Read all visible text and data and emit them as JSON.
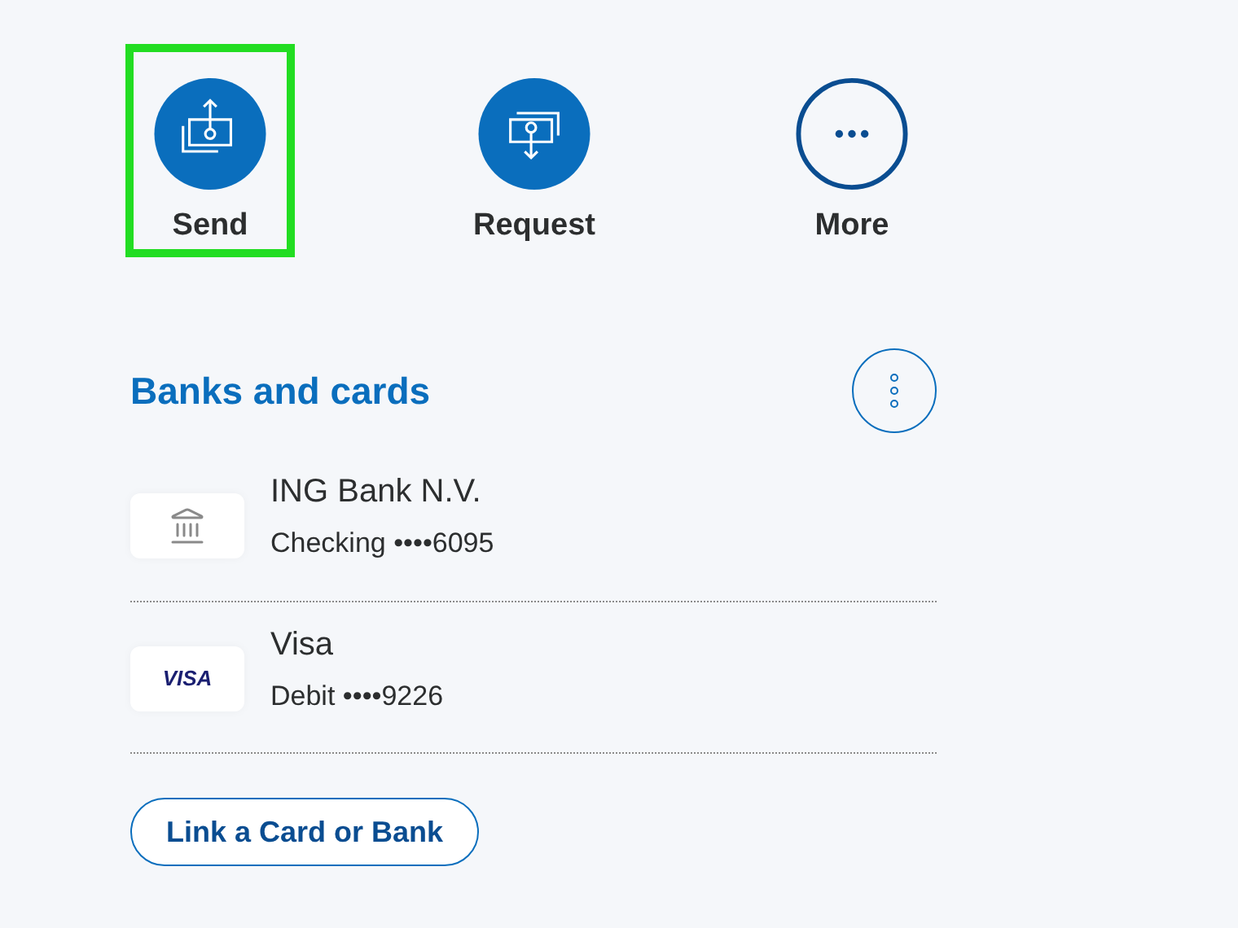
{
  "actions": [
    {
      "kind": "send",
      "label": "Send",
      "highlighted": true
    },
    {
      "kind": "request",
      "label": "Request",
      "highlighted": false
    },
    {
      "kind": "more",
      "label": "More",
      "highlighted": false
    }
  ],
  "banks_and_cards": {
    "title": "Banks and cards",
    "accounts": [
      {
        "kind": "bank",
        "name": "ING Bank N.V.",
        "detail": "Checking ••••6095"
      },
      {
        "kind": "card",
        "logo": "VISA",
        "name": "Visa",
        "detail": "Debit ••••9226"
      }
    ],
    "link_button": "Link a Card or Bank"
  }
}
